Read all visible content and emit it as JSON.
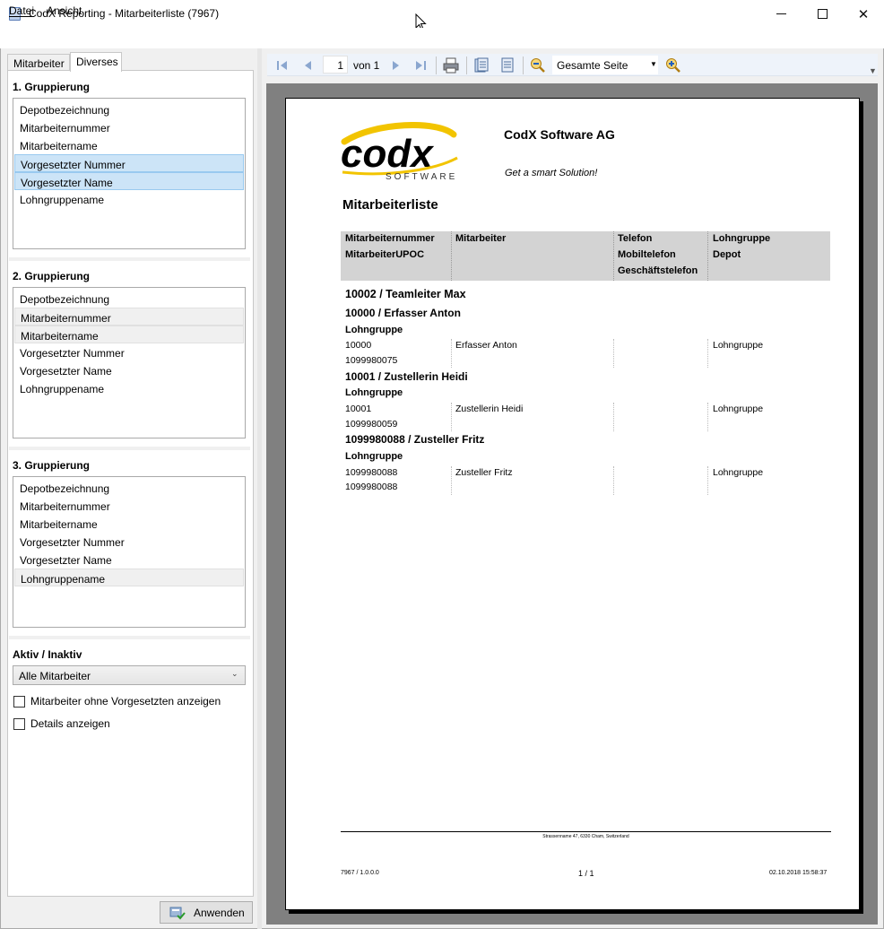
{
  "window": {
    "title": "CodX Reporting - Mitarbeiterliste (7967)"
  },
  "menu": {
    "datei": "Datei",
    "ansicht": "Ansicht"
  },
  "tabs": {
    "mitarbeiter": "Mitarbeiter",
    "diverses": "Diverses"
  },
  "groupings": [
    {
      "title": "1. Gruppierung",
      "items": [
        "Depotbezeichnung",
        "Mitarbeiternummer",
        "Mitarbeitername",
        "Vorgesetzter Nummer",
        "Vorgesetzter Name",
        "Lohngruppename"
      ]
    },
    {
      "title": "2. Gruppierung",
      "items": [
        "Depotbezeichnung",
        "Mitarbeiternummer",
        "Mitarbeitername",
        "Vorgesetzter Nummer",
        "Vorgesetzter Name",
        "Lohngruppename"
      ]
    },
    {
      "title": "3. Gruppierung",
      "items": [
        "Depotbezeichnung",
        "Mitarbeiternummer",
        "Mitarbeitername",
        "Vorgesetzter Nummer",
        "Vorgesetzter Name",
        "Lohngruppename"
      ]
    }
  ],
  "aktiv": {
    "title": "Aktiv / Inaktiv",
    "selected": "Alle Mitarbeiter"
  },
  "checkboxes": {
    "ohne_vorgesetzten": "Mitarbeiter ohne Vorgesetzten anzeigen",
    "details": "Details anzeigen"
  },
  "apply_label": "Anwenden",
  "toolbar": {
    "page": "1",
    "of_text": "von 1",
    "zoom": "Gesamte Seite"
  },
  "report": {
    "company": "CodX Software AG",
    "slogan": "Get a smart Solution!",
    "logo_text": "codx",
    "logo_sub": "SOFTWARE",
    "title": "Mitarbeiterliste",
    "headers": {
      "c1a": "Mitarbeiternummer",
      "c1b": "MitarbeiterUPOC",
      "c2a": "Mitarbeiter",
      "c3a": "Telefon",
      "c3b": "Mobiltelefon",
      "c3c": "Geschäftstelefon",
      "c4a": "Lohngruppe",
      "c4b": "Depot"
    },
    "group1": "10002 / Teamleiter Max",
    "group2": "10000 / Erfasser Anton",
    "lohngruppe_label": "Lohngruppe",
    "rows": [
      {
        "nr": "10000",
        "upoc": "1099980075",
        "name": "Erfasser Anton",
        "lohngruppe": "Lohngruppe"
      },
      {
        "nr": "10001",
        "upoc": "1099980059",
        "name": "Zustellerin Heidi",
        "lohngruppe": "Lohngruppe"
      },
      {
        "nr": "1099980088",
        "upoc": "1099980088",
        "name": "Zusteller  Fritz",
        "lohngruppe": "Lohngruppe"
      }
    ],
    "group2b": "10001 / Zustellerin Heidi",
    "group2c": "1099980088 / Zusteller  Fritz",
    "footer_address": "Strassenname 47, 6330 Cham, Switzerland",
    "footer_version": "7967 / 1.0.0.0",
    "footer_pages": "1 / 1",
    "footer_date": "02.10.2018 15:58:37"
  },
  "colors": {
    "selection": "#cce4f7",
    "logo_yellow": "#f2c400"
  }
}
